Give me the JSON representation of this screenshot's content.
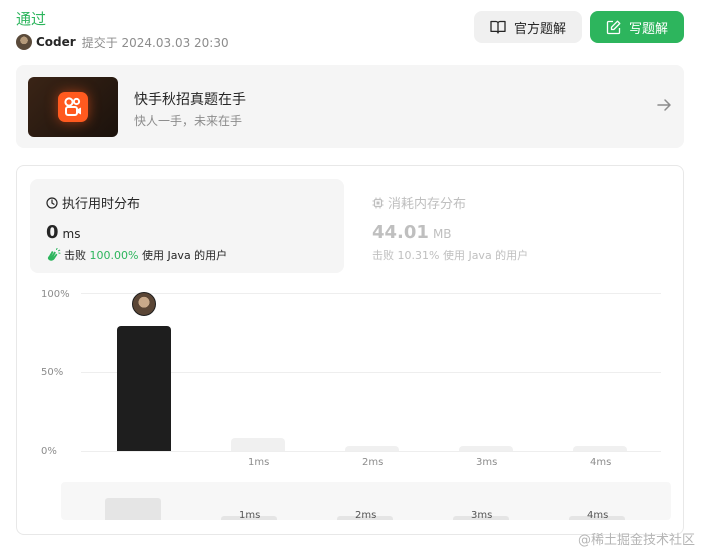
{
  "submission": {
    "status": "通过",
    "author": "Coder",
    "submitted_text": "提交于 2024.03.03 20:30"
  },
  "actions": {
    "official_solution": "官方题解",
    "write_solution": "写题解"
  },
  "banner": {
    "title": "快手秋招真题在手",
    "subtitle": "快人一手，未来在手"
  },
  "runtime": {
    "label": "执行用时分布",
    "value": "0",
    "unit": "ms",
    "beat_prefix": "击败",
    "beat_percent": "100.00%",
    "beat_suffix": "使用 Java 的用户"
  },
  "memory": {
    "label": "消耗内存分布",
    "value": "44.01",
    "unit": "MB",
    "beat_prefix": "击败",
    "beat_percent": "10.31%",
    "beat_suffix": "使用 Java 的用户"
  },
  "chart_data": {
    "type": "bar",
    "categories": [
      "0ms",
      "1ms",
      "2ms",
      "3ms",
      "4ms"
    ],
    "tick_labels": [
      "",
      "1ms",
      "2ms",
      "3ms",
      "4ms"
    ],
    "values": [
      79,
      8,
      3,
      3,
      3
    ],
    "highlight_index": 0,
    "y_ticks": [
      "100%",
      "50%",
      "0%"
    ],
    "ylim": [
      0,
      100
    ],
    "xlabel": "",
    "ylabel": "",
    "overview_values": [
      58,
      10,
      10,
      10,
      10
    ],
    "overview_ticks": [
      "",
      "1ms",
      "2ms",
      "3ms",
      "4ms"
    ],
    "colors": {
      "highlight": "#1e1e1e",
      "other": "#f0f0f0",
      "overview": "#e5e5e5"
    }
  },
  "watermark": "@稀土掘金技术社区",
  "colors": {
    "accent": "#2db55d"
  }
}
